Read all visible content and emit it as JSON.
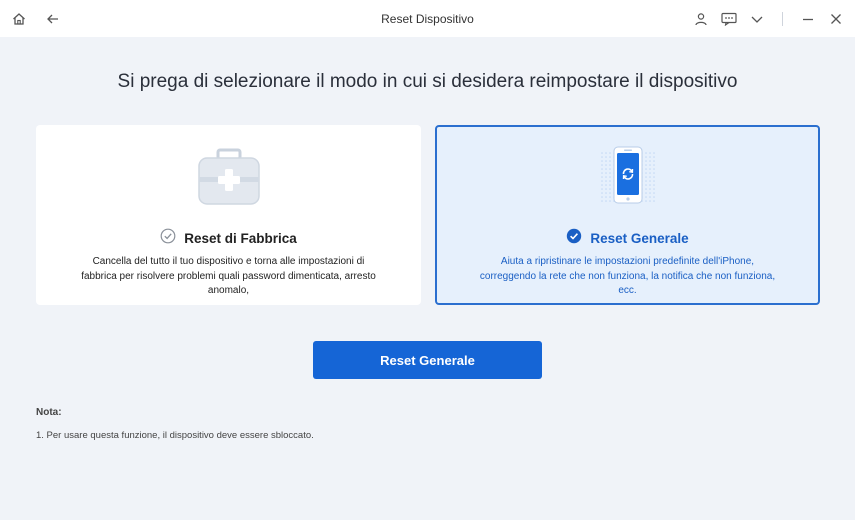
{
  "window": {
    "title": "Reset Dispositivo",
    "icons": [
      "home-icon",
      "back-icon",
      "user-icon",
      "feedback-icon",
      "chevron-down-icon",
      "minimize-icon",
      "close-icon"
    ]
  },
  "heading": "Si prega di selezionare il modo in cui si desidera reimpostare il dispositivo",
  "options": [
    {
      "title": "Reset di Fabbrica",
      "description": "Cancella del tutto il tuo dispositivo e torna alle impostazioni di fabbrica per risolvere problemi quali password dimenticata, arresto anomalo,",
      "selected": false,
      "icon": "toolbox-icon"
    },
    {
      "title": "Reset Generale",
      "description": "Aiuta a ripristinare le impostazioni predefinite dell'iPhone, correggendo la rete che non funziona, la notifica che non funziona, ecc.",
      "selected": true,
      "icon": "phone-reset-icon"
    }
  ],
  "action_button": "Reset Generale",
  "note": {
    "title": "Nota:",
    "items": [
      "1. Per usare questa funzione, il dispositivo deve essere sbloccato."
    ]
  },
  "colors": {
    "accent": "#1565d6",
    "selected_border": "#2b6fcf",
    "selected_bg": "#e6f0fc",
    "background": "#f0f3f8"
  }
}
